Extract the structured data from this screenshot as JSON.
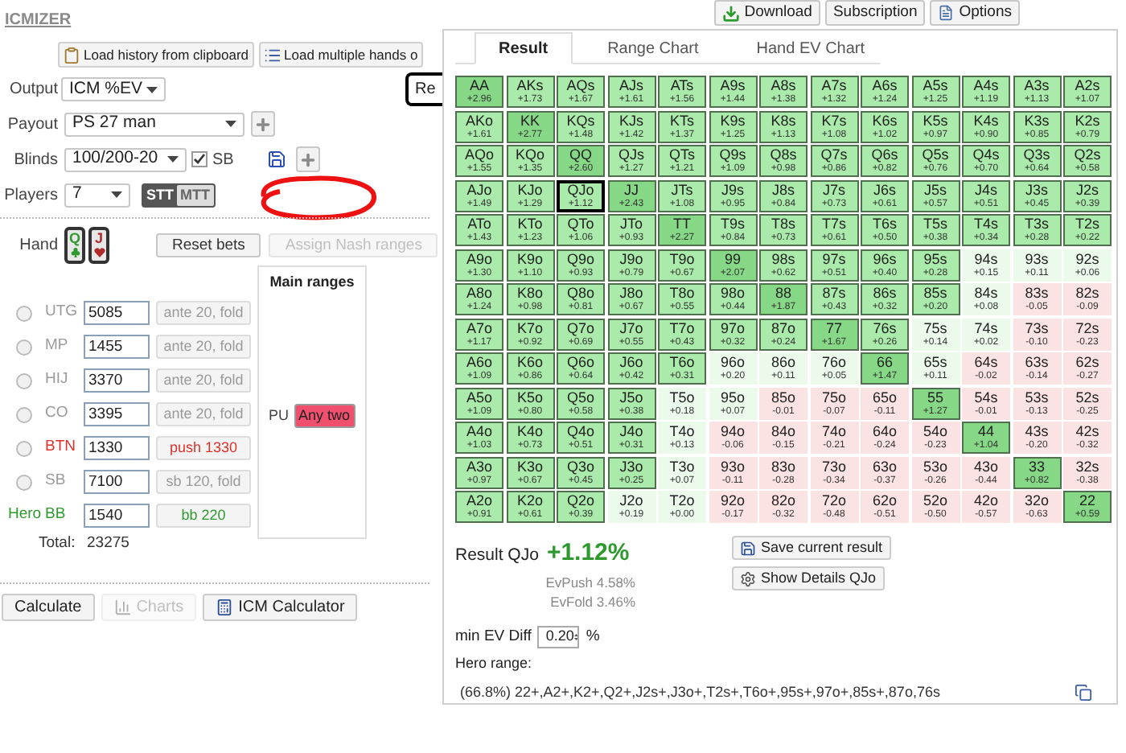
{
  "app": {
    "title": "ICMIZER"
  },
  "top_buttons": [
    {
      "label": "Download",
      "kind": "download"
    },
    {
      "label": "Subscription",
      "kind": "plain"
    },
    {
      "label": "Options",
      "kind": "options"
    }
  ],
  "load_buttons": [
    {
      "label": "Load history from clipboard",
      "kind": "clipboard"
    },
    {
      "label": "Load multiple hands o",
      "kind": "list"
    }
  ],
  "side_button": {
    "label": "Re"
  },
  "settings": {
    "output": {
      "label": "Output",
      "value": "ICM %EV"
    },
    "payout": {
      "label": "Payout",
      "value": "PS 27 man"
    },
    "blinds": {
      "label": "Blinds",
      "value": "100/200-20",
      "sb_label": "SB",
      "sb_checked": true
    },
    "players": {
      "label": "Players",
      "value": "7"
    },
    "mode": [
      {
        "label": "STT",
        "selected": true
      },
      {
        "label": "MTT",
        "selected": false
      }
    ]
  },
  "hand": {
    "label": "Hand",
    "cards": [
      {
        "rank": "Q",
        "kind": "club"
      },
      {
        "rank": "J",
        "kind": "heart"
      }
    ]
  },
  "hand_buttons": [
    {
      "label": "Reset bets",
      "disabled": false
    },
    {
      "label": "Assign Nash ranges",
      "disabled": true
    }
  ],
  "seats": [
    {
      "position": "UTG",
      "stack": "5085",
      "action": "ante 20, fold",
      "kind": "fold",
      "selected": false
    },
    {
      "position": "MP",
      "stack": "1455",
      "action": "ante 20, fold",
      "kind": "fold",
      "selected": false
    },
    {
      "position": "HIJ",
      "stack": "3370",
      "action": "ante 20, fold",
      "kind": "fold",
      "selected": false
    },
    {
      "position": "CO",
      "stack": "3395",
      "action": "ante 20, fold",
      "kind": "fold",
      "selected": false
    },
    {
      "position": "BTN",
      "stack": "1330",
      "action": "push 1330",
      "kind": "push",
      "selected": false
    },
    {
      "position": "SB",
      "stack": "7100",
      "action": "sb 120, fold",
      "kind": "fold",
      "selected": false
    },
    {
      "position": "BB",
      "stack": "1540",
      "action": "bb 220",
      "kind": "hero",
      "hero_label": "Hero"
    }
  ],
  "total": {
    "label": "Total:",
    "value": "23275"
  },
  "main_ranges": {
    "title": "Main ranges",
    "entries": [
      {
        "position": "PU",
        "range": "Any two"
      }
    ]
  },
  "bottom_buttons": [
    {
      "label": "Calculate",
      "disabled": false,
      "kind": "plain"
    },
    {
      "label": "Charts",
      "disabled": true,
      "kind": "chart"
    },
    {
      "label": "ICM Calculator",
      "disabled": false,
      "kind": "calculator"
    }
  ],
  "tabs": [
    {
      "label": "Result",
      "selected": true
    },
    {
      "label": "Range Chart",
      "selected": false
    },
    {
      "label": "Hand EV Chart",
      "selected": false
    }
  ],
  "grid": [
    [
      {
        "hand": "AA",
        "ev": "+2.96",
        "kind": "range",
        "selected": false
      },
      {
        "hand": "AKs",
        "ev": "+1.73",
        "kind": "range",
        "selected": false
      },
      {
        "hand": "AQs",
        "ev": "+1.67",
        "kind": "range",
        "selected": false
      },
      {
        "hand": "AJs",
        "ev": "+1.61",
        "kind": "range",
        "selected": false
      },
      {
        "hand": "ATs",
        "ev": "+1.56",
        "kind": "range",
        "selected": false
      },
      {
        "hand": "A9s",
        "ev": "+1.44",
        "kind": "range",
        "selected": false
      },
      {
        "hand": "A8s",
        "ev": "+1.38",
        "kind": "range",
        "selected": false
      },
      {
        "hand": "A7s",
        "ev": "+1.32",
        "kind": "range",
        "selected": false
      },
      {
        "hand": "A6s",
        "ev": "+1.24",
        "kind": "range",
        "selected": false
      },
      {
        "hand": "A5s",
        "ev": "+1.25",
        "kind": "range",
        "selected": false
      },
      {
        "hand": "A4s",
        "ev": "+1.19",
        "kind": "range",
        "selected": false
      },
      {
        "hand": "A3s",
        "ev": "+1.13",
        "kind": "range",
        "selected": false
      },
      {
        "hand": "A2s",
        "ev": "+1.07",
        "kind": "range",
        "selected": false
      }
    ],
    [
      {
        "hand": "AKo",
        "ev": "+1.61",
        "kind": "range",
        "selected": false
      },
      {
        "hand": "KK",
        "ev": "+2.77",
        "kind": "range",
        "selected": false
      },
      {
        "hand": "KQs",
        "ev": "+1.48",
        "kind": "range",
        "selected": false
      },
      {
        "hand": "KJs",
        "ev": "+1.42",
        "kind": "range",
        "selected": false
      },
      {
        "hand": "KTs",
        "ev": "+1.37",
        "kind": "range",
        "selected": false
      },
      {
        "hand": "K9s",
        "ev": "+1.25",
        "kind": "range",
        "selected": false
      },
      {
        "hand": "K8s",
        "ev": "+1.13",
        "kind": "range",
        "selected": false
      },
      {
        "hand": "K7s",
        "ev": "+1.08",
        "kind": "range",
        "selected": false
      },
      {
        "hand": "K6s",
        "ev": "+1.02",
        "kind": "range",
        "selected": false
      },
      {
        "hand": "K5s",
        "ev": "+0.97",
        "kind": "range",
        "selected": false
      },
      {
        "hand": "K4s",
        "ev": "+0.90",
        "kind": "range",
        "selected": false
      },
      {
        "hand": "K3s",
        "ev": "+0.85",
        "kind": "range",
        "selected": false
      },
      {
        "hand": "K2s",
        "ev": "+0.79",
        "kind": "range",
        "selected": false
      }
    ],
    [
      {
        "hand": "AQo",
        "ev": "+1.55",
        "kind": "range",
        "selected": false
      },
      {
        "hand": "KQo",
        "ev": "+1.35",
        "kind": "range",
        "selected": false
      },
      {
        "hand": "QQ",
        "ev": "+2.60",
        "kind": "range",
        "selected": false
      },
      {
        "hand": "QJs",
        "ev": "+1.27",
        "kind": "range",
        "selected": false
      },
      {
        "hand": "QTs",
        "ev": "+1.21",
        "kind": "range",
        "selected": false
      },
      {
        "hand": "Q9s",
        "ev": "+1.09",
        "kind": "range",
        "selected": false
      },
      {
        "hand": "Q8s",
        "ev": "+0.98",
        "kind": "range",
        "selected": false
      },
      {
        "hand": "Q7s",
        "ev": "+0.86",
        "kind": "range",
        "selected": false
      },
      {
        "hand": "Q6s",
        "ev": "+0.82",
        "kind": "range",
        "selected": false
      },
      {
        "hand": "Q5s",
        "ev": "+0.76",
        "kind": "range",
        "selected": false
      },
      {
        "hand": "Q4s",
        "ev": "+0.70",
        "kind": "range",
        "selected": false
      },
      {
        "hand": "Q3s",
        "ev": "+0.64",
        "kind": "range",
        "selected": false
      },
      {
        "hand": "Q2s",
        "ev": "+0.58",
        "kind": "range",
        "selected": false
      }
    ],
    [
      {
        "hand": "AJo",
        "ev": "+1.49",
        "kind": "range",
        "selected": false
      },
      {
        "hand": "KJo",
        "ev": "+1.29",
        "kind": "range",
        "selected": false
      },
      {
        "hand": "QJo",
        "ev": "+1.12",
        "kind": "range",
        "selected": true
      },
      {
        "hand": "JJ",
        "ev": "+2.43",
        "kind": "range",
        "selected": false
      },
      {
        "hand": "JTs",
        "ev": "+1.08",
        "kind": "range",
        "selected": false
      },
      {
        "hand": "J9s",
        "ev": "+0.95",
        "kind": "range",
        "selected": false
      },
      {
        "hand": "J8s",
        "ev": "+0.84",
        "kind": "range",
        "selected": false
      },
      {
        "hand": "J7s",
        "ev": "+0.73",
        "kind": "range",
        "selected": false
      },
      {
        "hand": "J6s",
        "ev": "+0.61",
        "kind": "range",
        "selected": false
      },
      {
        "hand": "J5s",
        "ev": "+0.57",
        "kind": "range",
        "selected": false
      },
      {
        "hand": "J4s",
        "ev": "+0.51",
        "kind": "range",
        "selected": false
      },
      {
        "hand": "J3s",
        "ev": "+0.45",
        "kind": "range",
        "selected": false
      },
      {
        "hand": "J2s",
        "ev": "+0.39",
        "kind": "range",
        "selected": false
      }
    ],
    [
      {
        "hand": "ATo",
        "ev": "+1.43",
        "kind": "range",
        "selected": false
      },
      {
        "hand": "KTo",
        "ev": "+1.23",
        "kind": "range",
        "selected": false
      },
      {
        "hand": "QTo",
        "ev": "+1.06",
        "kind": "range",
        "selected": false
      },
      {
        "hand": "JTo",
        "ev": "+0.93",
        "kind": "range",
        "selected": false
      },
      {
        "hand": "TT",
        "ev": "+2.27",
        "kind": "range",
        "selected": false
      },
      {
        "hand": "T9s",
        "ev": "+0.84",
        "kind": "range",
        "selected": false
      },
      {
        "hand": "T8s",
        "ev": "+0.73",
        "kind": "range",
        "selected": false
      },
      {
        "hand": "T7s",
        "ev": "+0.61",
        "kind": "range",
        "selected": false
      },
      {
        "hand": "T6s",
        "ev": "+0.50",
        "kind": "range",
        "selected": false
      },
      {
        "hand": "T5s",
        "ev": "+0.38",
        "kind": "range",
        "selected": false
      },
      {
        "hand": "T4s",
        "ev": "+0.34",
        "kind": "range",
        "selected": false
      },
      {
        "hand": "T3s",
        "ev": "+0.28",
        "kind": "range",
        "selected": false
      },
      {
        "hand": "T2s",
        "ev": "+0.22",
        "kind": "range",
        "selected": false
      }
    ],
    [
      {
        "hand": "A9o",
        "ev": "+1.30",
        "kind": "range",
        "selected": false
      },
      {
        "hand": "K9o",
        "ev": "+1.10",
        "kind": "range",
        "selected": false
      },
      {
        "hand": "Q9o",
        "ev": "+0.93",
        "kind": "range",
        "selected": false
      },
      {
        "hand": "J9o",
        "ev": "+0.79",
        "kind": "range",
        "selected": false
      },
      {
        "hand": "T9o",
        "ev": "+0.67",
        "kind": "range",
        "selected": false
      },
      {
        "hand": "99",
        "ev": "+2.07",
        "kind": "range",
        "selected": false
      },
      {
        "hand": "98s",
        "ev": "+0.62",
        "kind": "range",
        "selected": false
      },
      {
        "hand": "97s",
        "ev": "+0.51",
        "kind": "range",
        "selected": false
      },
      {
        "hand": "96s",
        "ev": "+0.40",
        "kind": "range",
        "selected": false
      },
      {
        "hand": "95s",
        "ev": "+0.28",
        "kind": "range",
        "selected": false
      },
      {
        "hand": "94s",
        "ev": "+0.15",
        "kind": "plus",
        "selected": false
      },
      {
        "hand": "93s",
        "ev": "+0.11",
        "kind": "plus",
        "selected": false
      },
      {
        "hand": "92s",
        "ev": "+0.06",
        "kind": "plus",
        "selected": false
      }
    ],
    [
      {
        "hand": "A8o",
        "ev": "+1.24",
        "kind": "range",
        "selected": false
      },
      {
        "hand": "K8o",
        "ev": "+0.98",
        "kind": "range",
        "selected": false
      },
      {
        "hand": "Q8o",
        "ev": "+0.81",
        "kind": "range",
        "selected": false
      },
      {
        "hand": "J8o",
        "ev": "+0.67",
        "kind": "range",
        "selected": false
      },
      {
        "hand": "T8o",
        "ev": "+0.55",
        "kind": "range",
        "selected": false
      },
      {
        "hand": "98o",
        "ev": "+0.44",
        "kind": "range",
        "selected": false
      },
      {
        "hand": "88",
        "ev": "+1.87",
        "kind": "range",
        "selected": false
      },
      {
        "hand": "87s",
        "ev": "+0.43",
        "kind": "range",
        "selected": false
      },
      {
        "hand": "86s",
        "ev": "+0.32",
        "kind": "range",
        "selected": false
      },
      {
        "hand": "85s",
        "ev": "+0.20",
        "kind": "range",
        "selected": false
      },
      {
        "hand": "84s",
        "ev": "+0.08",
        "kind": "plus",
        "selected": false
      },
      {
        "hand": "83s",
        "ev": "-0.05",
        "kind": "minus",
        "selected": false
      },
      {
        "hand": "82s",
        "ev": "-0.09",
        "kind": "minus",
        "selected": false
      }
    ],
    [
      {
        "hand": "A7o",
        "ev": "+1.17",
        "kind": "range",
        "selected": false
      },
      {
        "hand": "K7o",
        "ev": "+0.92",
        "kind": "range",
        "selected": false
      },
      {
        "hand": "Q7o",
        "ev": "+0.69",
        "kind": "range",
        "selected": false
      },
      {
        "hand": "J7o",
        "ev": "+0.55",
        "kind": "range",
        "selected": false
      },
      {
        "hand": "T7o",
        "ev": "+0.43",
        "kind": "range",
        "selected": false
      },
      {
        "hand": "97o",
        "ev": "+0.32",
        "kind": "range",
        "selected": false
      },
      {
        "hand": "87o",
        "ev": "+0.24",
        "kind": "range",
        "selected": false
      },
      {
        "hand": "77",
        "ev": "+1.67",
        "kind": "range",
        "selected": false
      },
      {
        "hand": "76s",
        "ev": "+0.26",
        "kind": "range",
        "selected": false
      },
      {
        "hand": "75s",
        "ev": "+0.14",
        "kind": "plus",
        "selected": false
      },
      {
        "hand": "74s",
        "ev": "+0.02",
        "kind": "plus",
        "selected": false
      },
      {
        "hand": "73s",
        "ev": "-0.10",
        "kind": "minus",
        "selected": false
      },
      {
        "hand": "72s",
        "ev": "-0.23",
        "kind": "minus",
        "selected": false
      }
    ],
    [
      {
        "hand": "A6o",
        "ev": "+1.09",
        "kind": "range",
        "selected": false
      },
      {
        "hand": "K6o",
        "ev": "+0.86",
        "kind": "range",
        "selected": false
      },
      {
        "hand": "Q6o",
        "ev": "+0.64",
        "kind": "range",
        "selected": false
      },
      {
        "hand": "J6o",
        "ev": "+0.42",
        "kind": "range",
        "selected": false
      },
      {
        "hand": "T6o",
        "ev": "+0.31",
        "kind": "range",
        "selected": false
      },
      {
        "hand": "96o",
        "ev": "+0.20",
        "kind": "plus",
        "selected": false
      },
      {
        "hand": "86o",
        "ev": "+0.11",
        "kind": "plus",
        "selected": false
      },
      {
        "hand": "76o",
        "ev": "+0.05",
        "kind": "plus",
        "selected": false
      },
      {
        "hand": "66",
        "ev": "+1.47",
        "kind": "range",
        "selected": false
      },
      {
        "hand": "65s",
        "ev": "+0.11",
        "kind": "plus",
        "selected": false
      },
      {
        "hand": "64s",
        "ev": "-0.02",
        "kind": "minus",
        "selected": false
      },
      {
        "hand": "63s",
        "ev": "-0.14",
        "kind": "minus",
        "selected": false
      },
      {
        "hand": "62s",
        "ev": "-0.27",
        "kind": "minus",
        "selected": false
      }
    ],
    [
      {
        "hand": "A5o",
        "ev": "+1.09",
        "kind": "range",
        "selected": false
      },
      {
        "hand": "K5o",
        "ev": "+0.80",
        "kind": "range",
        "selected": false
      },
      {
        "hand": "Q5o",
        "ev": "+0.58",
        "kind": "range",
        "selected": false
      },
      {
        "hand": "J5o",
        "ev": "+0.38",
        "kind": "range",
        "selected": false
      },
      {
        "hand": "T5o",
        "ev": "+0.18",
        "kind": "plus",
        "selected": false
      },
      {
        "hand": "95o",
        "ev": "+0.07",
        "kind": "plus",
        "selected": false
      },
      {
        "hand": "85o",
        "ev": "-0.01",
        "kind": "minus",
        "selected": false
      },
      {
        "hand": "75o",
        "ev": "-0.07",
        "kind": "minus",
        "selected": false
      },
      {
        "hand": "65o",
        "ev": "-0.11",
        "kind": "minus",
        "selected": false
      },
      {
        "hand": "55",
        "ev": "+1.27",
        "kind": "range",
        "selected": false
      },
      {
        "hand": "54s",
        "ev": "-0.01",
        "kind": "minus",
        "selected": false
      },
      {
        "hand": "53s",
        "ev": "-0.13",
        "kind": "minus",
        "selected": false
      },
      {
        "hand": "52s",
        "ev": "-0.25",
        "kind": "minus",
        "selected": false
      }
    ],
    [
      {
        "hand": "A4o",
        "ev": "+1.03",
        "kind": "range",
        "selected": false
      },
      {
        "hand": "K4o",
        "ev": "+0.73",
        "kind": "range",
        "selected": false
      },
      {
        "hand": "Q4o",
        "ev": "+0.51",
        "kind": "range",
        "selected": false
      },
      {
        "hand": "J4o",
        "ev": "+0.31",
        "kind": "range",
        "selected": false
      },
      {
        "hand": "T4o",
        "ev": "+0.13",
        "kind": "plus",
        "selected": false
      },
      {
        "hand": "94o",
        "ev": "-0.06",
        "kind": "minus",
        "selected": false
      },
      {
        "hand": "84o",
        "ev": "-0.15",
        "kind": "minus",
        "selected": false
      },
      {
        "hand": "74o",
        "ev": "-0.21",
        "kind": "minus",
        "selected": false
      },
      {
        "hand": "64o",
        "ev": "-0.24",
        "kind": "minus",
        "selected": false
      },
      {
        "hand": "54o",
        "ev": "-0.23",
        "kind": "minus",
        "selected": false
      },
      {
        "hand": "44",
        "ev": "+1.04",
        "kind": "range",
        "selected": false
      },
      {
        "hand": "43s",
        "ev": "-0.20",
        "kind": "minus",
        "selected": false
      },
      {
        "hand": "42s",
        "ev": "-0.32",
        "kind": "minus",
        "selected": false
      }
    ],
    [
      {
        "hand": "A3o",
        "ev": "+0.97",
        "kind": "range",
        "selected": false
      },
      {
        "hand": "K3o",
        "ev": "+0.67",
        "kind": "range",
        "selected": false
      },
      {
        "hand": "Q3o",
        "ev": "+0.45",
        "kind": "range",
        "selected": false
      },
      {
        "hand": "J3o",
        "ev": "+0.25",
        "kind": "range",
        "selected": false
      },
      {
        "hand": "T3o",
        "ev": "+0.07",
        "kind": "plus",
        "selected": false
      },
      {
        "hand": "93o",
        "ev": "-0.11",
        "kind": "minus",
        "selected": false
      },
      {
        "hand": "83o",
        "ev": "-0.28",
        "kind": "minus",
        "selected": false
      },
      {
        "hand": "73o",
        "ev": "-0.34",
        "kind": "minus",
        "selected": false
      },
      {
        "hand": "63o",
        "ev": "-0.37",
        "kind": "minus",
        "selected": false
      },
      {
        "hand": "53o",
        "ev": "-0.26",
        "kind": "minus",
        "selected": false
      },
      {
        "hand": "43o",
        "ev": "-0.44",
        "kind": "minus",
        "selected": false
      },
      {
        "hand": "33",
        "ev": "+0.82",
        "kind": "range",
        "selected": false
      },
      {
        "hand": "32s",
        "ev": "-0.38",
        "kind": "minus",
        "selected": false
      }
    ],
    [
      {
        "hand": "A2o",
        "ev": "+0.91",
        "kind": "range",
        "selected": false
      },
      {
        "hand": "K2o",
        "ev": "+0.61",
        "kind": "range",
        "selected": false
      },
      {
        "hand": "Q2o",
        "ev": "+0.39",
        "kind": "range",
        "selected": false
      },
      {
        "hand": "J2o",
        "ev": "+0.19",
        "kind": "plus",
        "selected": false
      },
      {
        "hand": "T2o",
        "ev": "+0.00",
        "kind": "plus",
        "selected": false
      },
      {
        "hand": "92o",
        "ev": "-0.17",
        "kind": "minus",
        "selected": false
      },
      {
        "hand": "82o",
        "ev": "-0.32",
        "kind": "minus",
        "selected": false
      },
      {
        "hand": "72o",
        "ev": "-0.48",
        "kind": "minus",
        "selected": false
      },
      {
        "hand": "62o",
        "ev": "-0.51",
        "kind": "minus",
        "selected": false
      },
      {
        "hand": "52o",
        "ev": "-0.50",
        "kind": "minus",
        "selected": false
      },
      {
        "hand": "42o",
        "ev": "-0.57",
        "kind": "minus",
        "selected": false
      },
      {
        "hand": "32o",
        "ev": "-0.63",
        "kind": "minus",
        "selected": false
      },
      {
        "hand": "22",
        "ev": "+0.59",
        "kind": "range",
        "selected": false
      }
    ]
  ],
  "result": {
    "label": "Result QJo",
    "value": "+1.12%",
    "ev_push": "EvPush 4.58%",
    "ev_fold": "EvFold 3.46%"
  },
  "result_buttons": [
    {
      "label": "Save current result",
      "kind": "save"
    },
    {
      "label": "Show Details QJo",
      "kind": "details"
    }
  ],
  "min_ev": {
    "label": "min EV Diff",
    "value": "0.20",
    "unit": "%"
  },
  "hero_range": {
    "label": "Hero range:",
    "text": "(66.8%) 22+,A2+,K2+,Q2+,J2s+,J3o+,T2s+,T6o+,95s+,97o+,85s+,87o,76s"
  }
}
